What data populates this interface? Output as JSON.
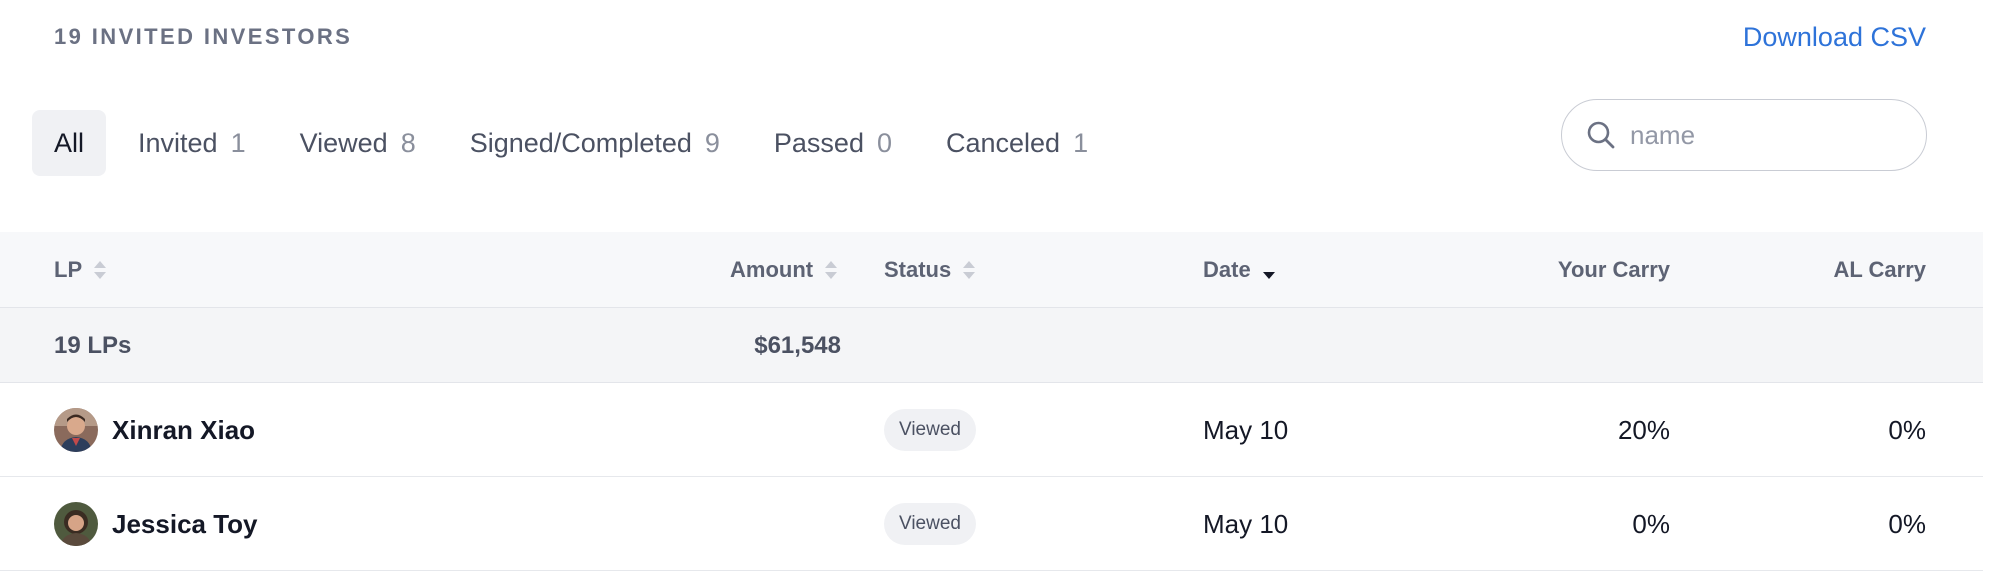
{
  "header": {
    "title": "19 INVITED INVESTORS",
    "download_label": "Download CSV"
  },
  "tabs": [
    {
      "label": "All",
      "count": ""
    },
    {
      "label": "Invited",
      "count": "1"
    },
    {
      "label": "Viewed",
      "count": "8"
    },
    {
      "label": "Signed/Completed",
      "count": "9"
    },
    {
      "label": "Passed",
      "count": "0"
    },
    {
      "label": "Canceled",
      "count": "1"
    }
  ],
  "search": {
    "placeholder": "name",
    "value": ""
  },
  "columns": {
    "lp": "LP",
    "amount": "Amount",
    "status": "Status",
    "date": "Date",
    "your_carry": "Your Carry",
    "al_carry": "AL Carry"
  },
  "summary": {
    "lp_count": "19 LPs",
    "amount_total": "$61,548"
  },
  "rows": [
    {
      "name": "Xinran Xiao",
      "amount": "",
      "status": "Viewed",
      "date": "May 10",
      "your_carry": "20%",
      "al_carry": "0%"
    },
    {
      "name": "Jessica Toy",
      "amount": "",
      "status": "Viewed",
      "date": "May 10",
      "your_carry": "0%",
      "al_carry": "0%"
    }
  ],
  "colors": {
    "accent": "#2e73d9",
    "header_bg": "#f7f8fa",
    "summary_bg": "#f4f5f7",
    "badge_bg": "#f0f1f4"
  }
}
